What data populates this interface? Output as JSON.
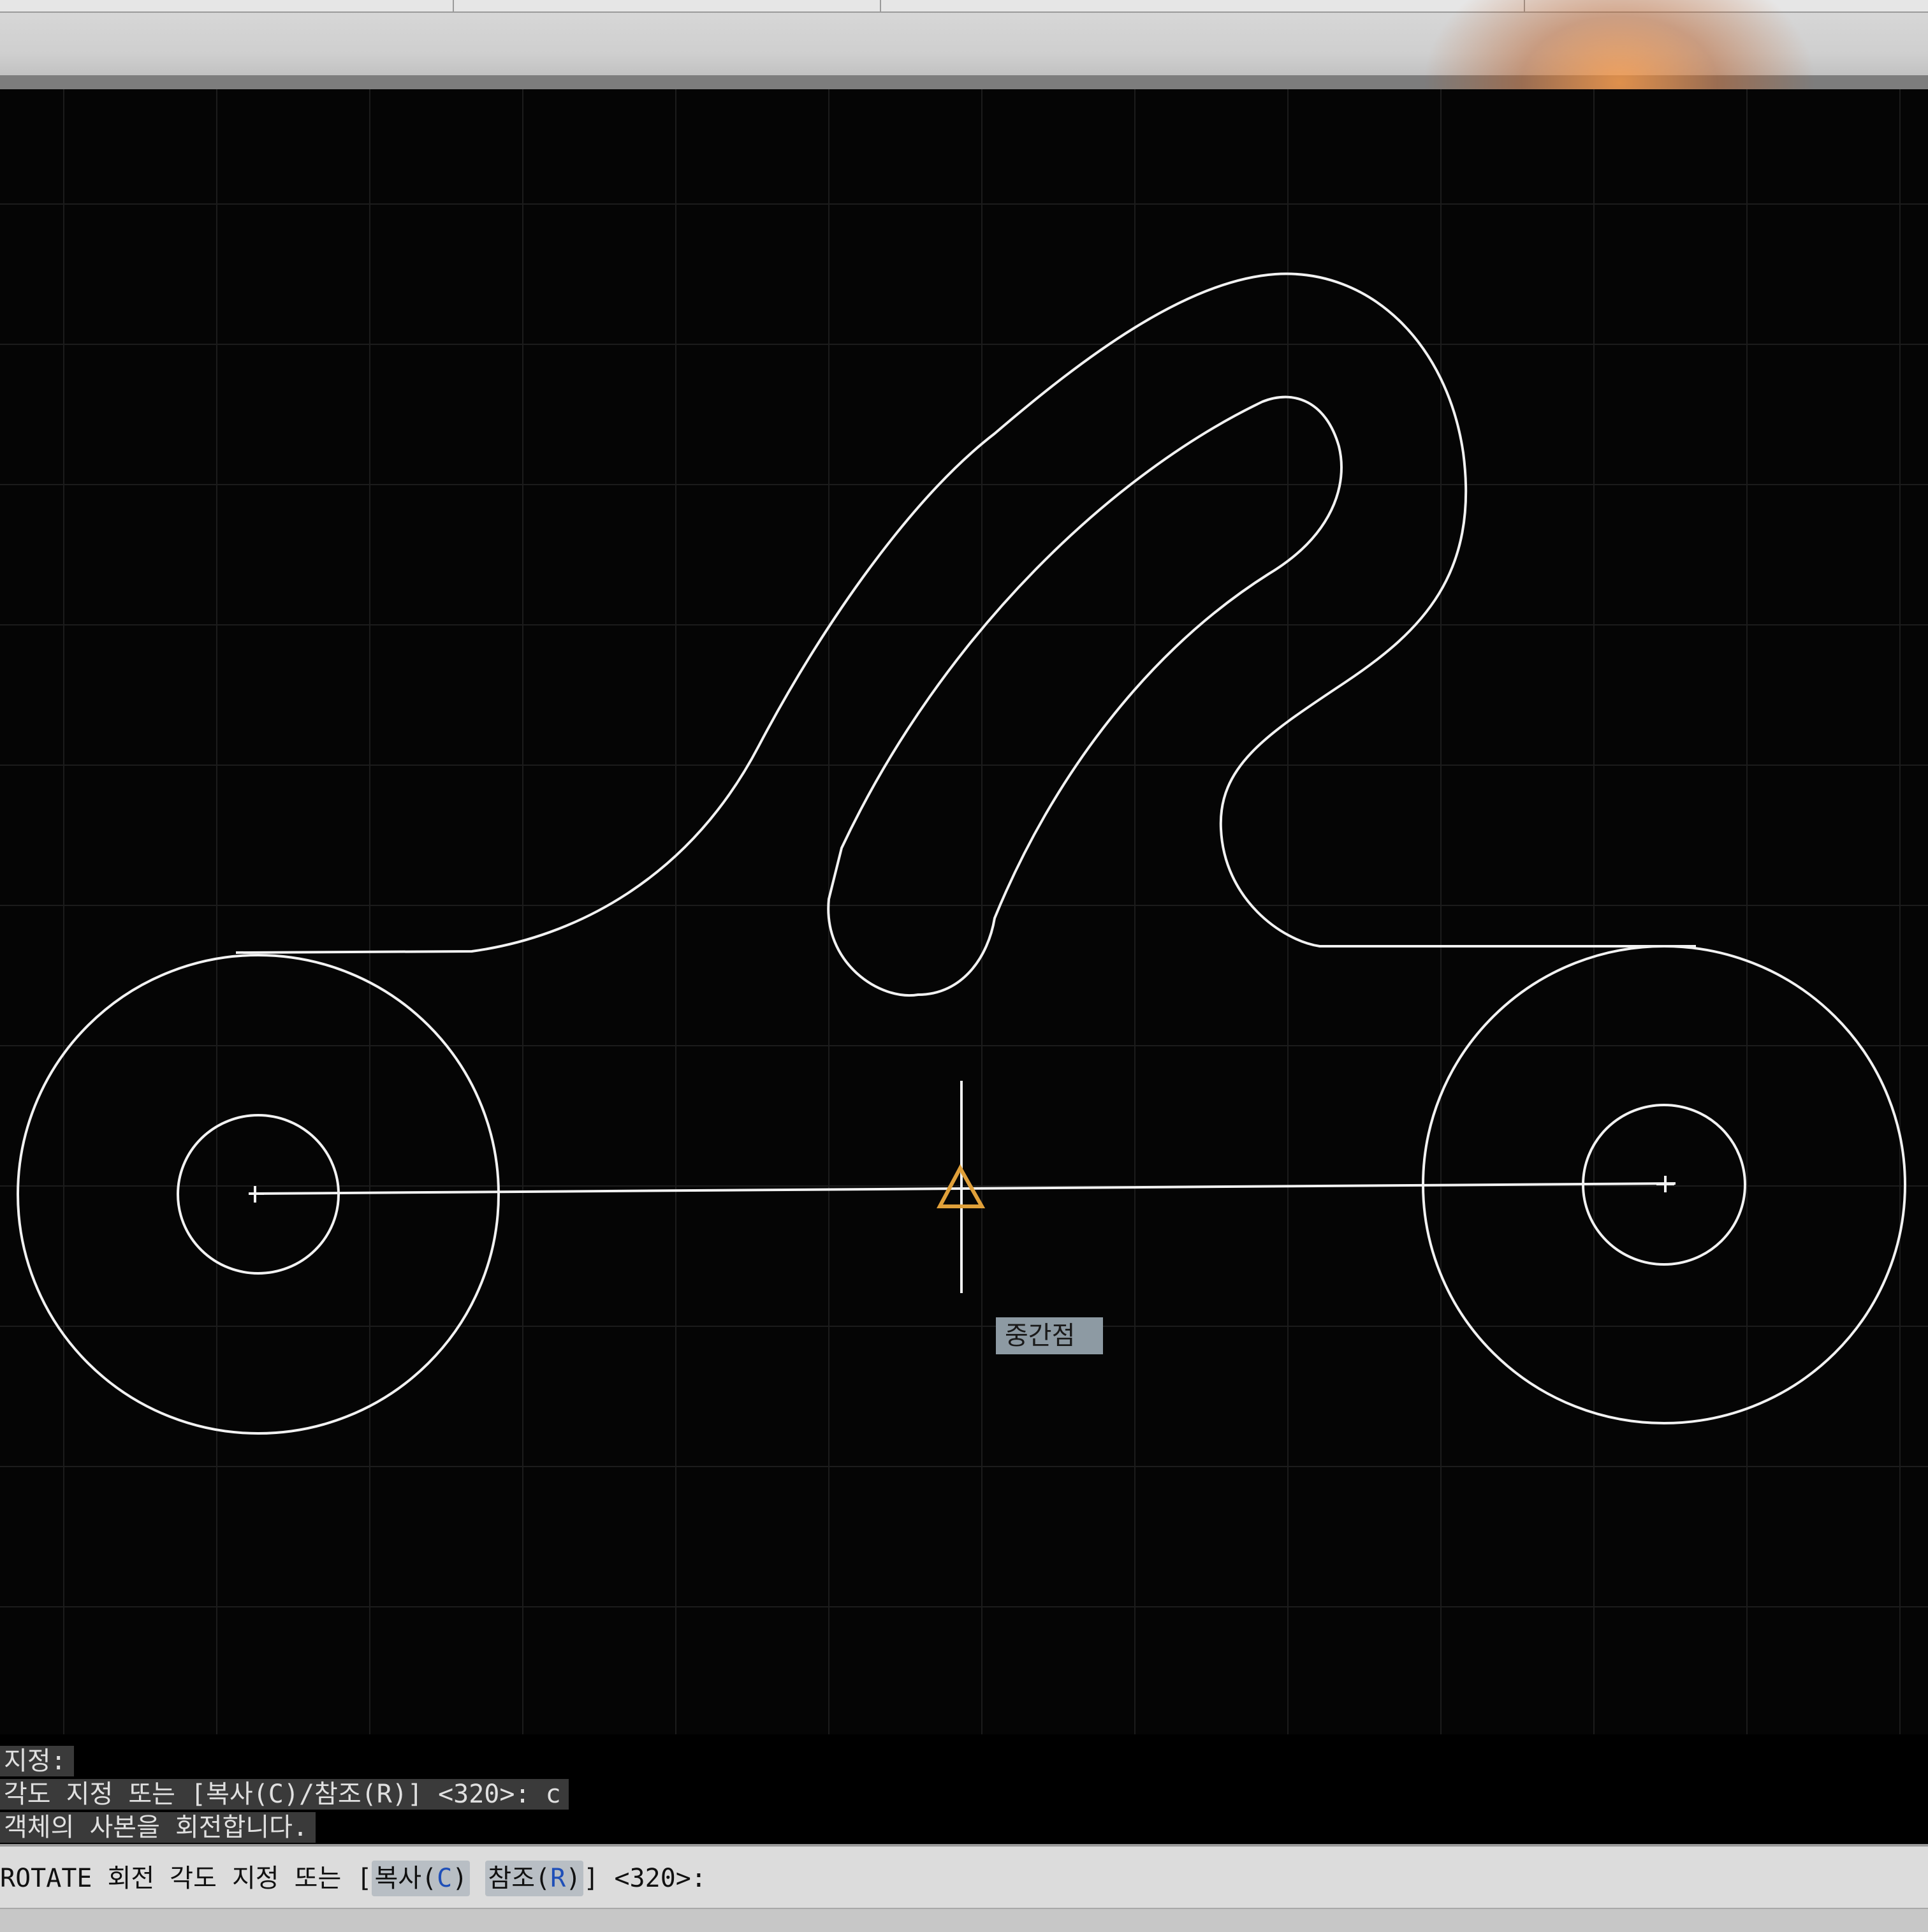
{
  "colors": {
    "background": "#050505",
    "grid": "#1e1e1e",
    "geometry": "#f2f2f2",
    "snap_marker": "#e0a03a",
    "tooltip_bg": "#8d9aa3",
    "command_bg": "#dcdcdc",
    "option_key": "#1f4fb8"
  },
  "snap": {
    "tooltip": "중간점",
    "icon": "midpoint-triangle-icon"
  },
  "history": {
    "line1": "지정:",
    "line2": "각도 지정 또는 [복사(C)/참조(R)] <320>: c",
    "line3": "객체의 사본을 회전합니다."
  },
  "command": {
    "name": "ROTATE",
    "prompt": "회전 각도 지정 또는",
    "bracket_open": "[",
    "option1_label": "복사(",
    "option1_key": "C",
    "option1_close": ")",
    "option2_label": "참조(",
    "option2_key": "R",
    "option2_close": ")",
    "bracket_close": "]",
    "default_value": "<320>:"
  }
}
